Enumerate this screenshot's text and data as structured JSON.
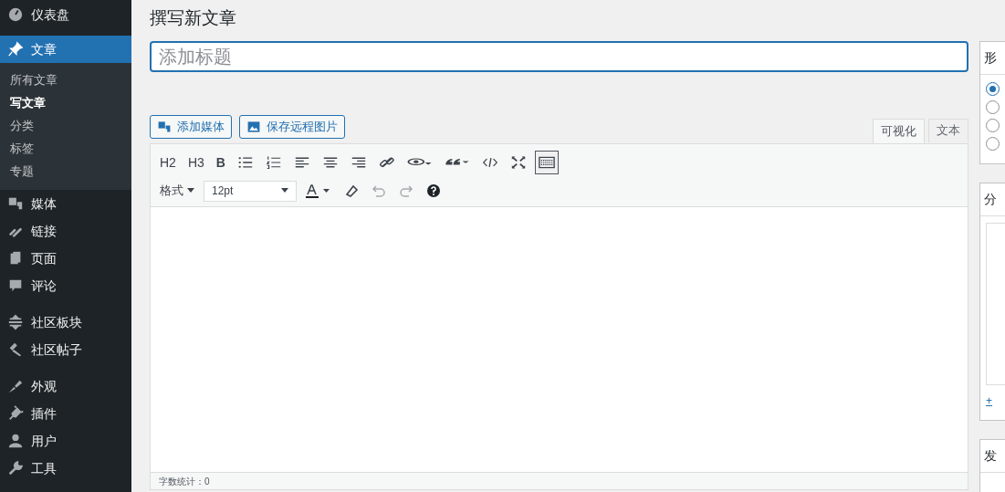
{
  "sidebar": {
    "groups": [
      [
        {
          "label": "仪表盘",
          "selected": false
        }
      ],
      [
        {
          "label": "文章",
          "selected": true,
          "children": [
            {
              "label": "所有文章",
              "selected": false
            },
            {
              "label": "写文章",
              "selected": true
            },
            {
              "label": "分类",
              "selected": false
            },
            {
              "label": "标签",
              "selected": false
            },
            {
              "label": "专题",
              "selected": false
            }
          ]
        },
        {
          "label": "媒体",
          "selected": false
        },
        {
          "label": "链接",
          "selected": false
        },
        {
          "label": "页面",
          "selected": false
        },
        {
          "label": "评论",
          "selected": false
        }
      ],
      [
        {
          "label": "社区板块",
          "selected": false
        },
        {
          "label": "社区帖子",
          "selected": false
        }
      ],
      [
        {
          "label": "外观",
          "selected": false
        },
        {
          "label": "插件",
          "selected": false
        },
        {
          "label": "用户",
          "selected": false
        },
        {
          "label": "工具",
          "selected": false
        }
      ]
    ]
  },
  "page_title": "撰写新文章",
  "title_field": {
    "placeholder": "添加标题"
  },
  "media_buttons": [
    "添加媒体",
    "保存远程图片"
  ],
  "editor_tabs": [
    {
      "label": "可视化",
      "selected": true
    },
    {
      "label": "文本",
      "selected": false
    }
  ],
  "toolbar_row_1": [
    {
      "kind": "text",
      "label": "H2"
    },
    {
      "kind": "text",
      "label": "H3"
    },
    {
      "kind": "bold",
      "label": "B"
    },
    {
      "kind": "icon"
    },
    {
      "kind": "icon"
    },
    {
      "kind": "icon"
    },
    {
      "kind": "icon"
    },
    {
      "kind": "icon"
    },
    {
      "kind": "icon"
    },
    {
      "kind": "icon"
    },
    {
      "kind": "icon"
    },
    {
      "kind": "icon"
    },
    {
      "kind": "icon"
    },
    {
      "kind": "icon",
      "pressed": true
    }
  ],
  "toolbar_row_2": {
    "format_label": "格式",
    "font_size": "12pt",
    "undo_disabled": true,
    "redo_disabled": true
  },
  "word_count": "字数统计：0",
  "side_panels": [
    {
      "title": "形",
      "radios": [
        {
          "selected": true
        },
        {
          "selected": false
        },
        {
          "selected": false
        },
        {
          "selected": false
        }
      ]
    },
    {
      "title": "分",
      "link": "+"
    },
    {
      "title": "发"
    }
  ]
}
